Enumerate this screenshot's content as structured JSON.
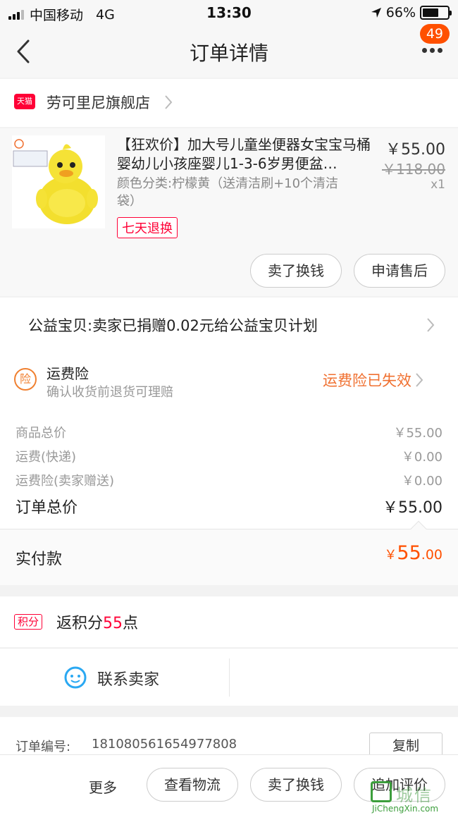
{
  "status_bar": {
    "carrier": "中国移动",
    "network": "4G",
    "time": "13:30",
    "battery": "66%",
    "battery_level": 0.66
  },
  "nav": {
    "title": "订单详情",
    "badge": "49"
  },
  "shop": {
    "name": "劳可里尼旗舰店",
    "badge": "天猫"
  },
  "product": {
    "title": "【狂欢价】加大号儿童坐便器女宝宝马桶婴幼儿小孩座婴儿1-3-6岁男便盆…",
    "sku": "颜色分类:柠檬黄（送清洁刷+10个清洁袋）",
    "tag": "七天退换",
    "price": "￥55.00",
    "original_price": "￥118.00",
    "quantity": "x1",
    "actions": [
      "卖了换钱",
      "申请售后"
    ]
  },
  "charity": {
    "text": "公益宝贝:卖家已捐赠0.02元给公益宝贝计划"
  },
  "insurance": {
    "icon_char": "险",
    "title": "运费险",
    "subtitle": "确认收货前退货可理赔",
    "status": "运费险已失效"
  },
  "summary": {
    "rows": [
      {
        "label": "商品总价",
        "value": "￥55.00"
      },
      {
        "label": "运费(快递)",
        "value": "￥0.00"
      },
      {
        "label": "运费险(卖家赠送)",
        "value": "￥0.00"
      }
    ],
    "total_label": "订单总价",
    "total_value": "￥55.00"
  },
  "paid": {
    "label": "实付款",
    "symbol": "￥",
    "integer": "55",
    "decimal": ".00"
  },
  "points": {
    "tag": "积分",
    "prefix": "返积分",
    "amount": "55",
    "suffix": "点"
  },
  "contact": {
    "label": "联系卖家"
  },
  "order": {
    "label": "订单编号:",
    "number": "181080561654977808",
    "copy_label": "复制"
  },
  "bottom_bar": {
    "more": "更多",
    "buttons": [
      "查看物流",
      "卖了换钱",
      "追加评价"
    ]
  },
  "watermark": {
    "cn": "城信",
    "en": "JiChengXin.com"
  },
  "colors": {
    "accent": "#ff5000",
    "tmall_red": "#ff0036",
    "orange": "#f07030"
  }
}
